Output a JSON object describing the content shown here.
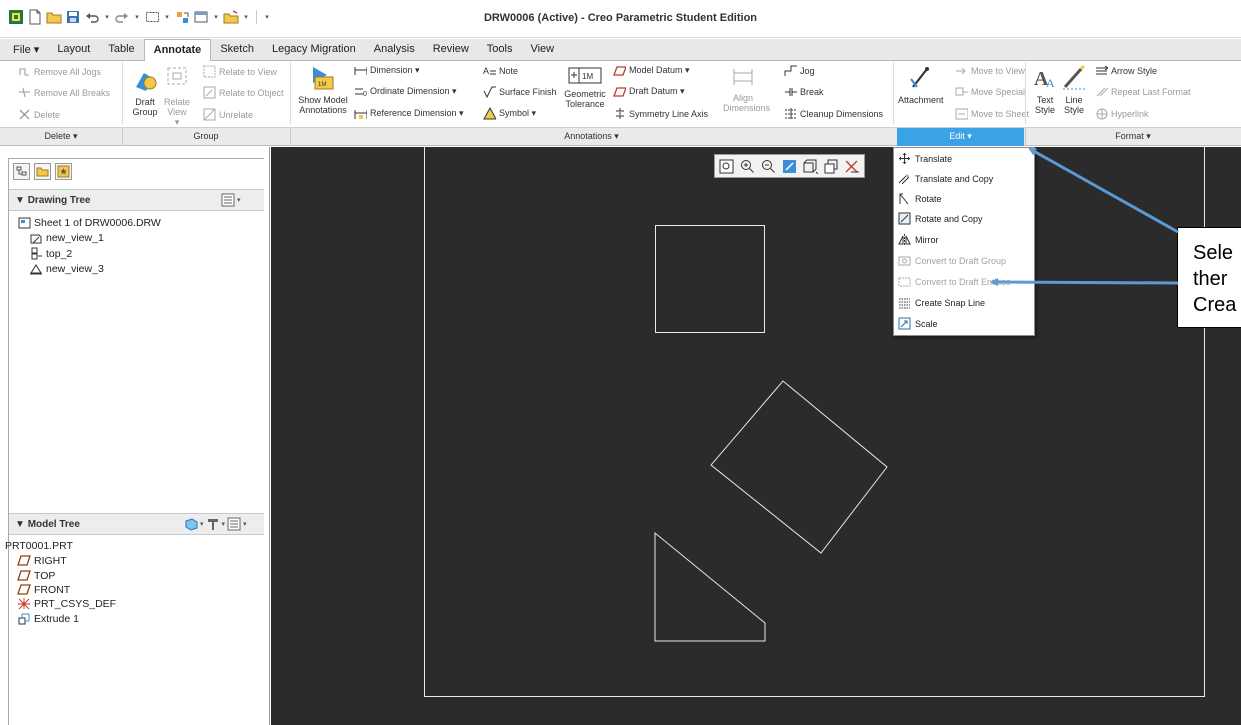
{
  "window": {
    "title": "DRW0006 (Active) - Creo Parametric Student Edition"
  },
  "tabs": [
    {
      "label": "File ▾"
    },
    {
      "label": "Layout"
    },
    {
      "label": "Table"
    },
    {
      "label": "Annotate"
    },
    {
      "label": "Sketch"
    },
    {
      "label": "Legacy Migration"
    },
    {
      "label": "Analysis"
    },
    {
      "label": "Review"
    },
    {
      "label": "Tools"
    },
    {
      "label": "View"
    }
  ],
  "ribbon": {
    "delete": {
      "remove_all_jogs": "Remove All Jogs",
      "remove_all_breaks": "Remove All Breaks",
      "delete": "Delete"
    },
    "group": {
      "draft_group": "Draft Group",
      "relate_view": "Relate View ▾",
      "relate_to_view": "Relate to View",
      "relate_to_object": "Relate to Object",
      "unrelate": "Unrelate"
    },
    "annotations": {
      "show_model_annotations": "Show Model Annotations",
      "dimension": "Dimension ▾",
      "ordinate_dimension": "Ordinate Dimension ▾",
      "reference_dimension": "Reference Dimension ▾",
      "note": "Note",
      "surface_finish": "Surface Finish",
      "symbol": "Symbol ▾",
      "geometric_tolerance": "Geometric Tolerance",
      "model_datum": "Model Datum ▾",
      "draft_datum": "Draft Datum ▾",
      "symmetry_line_axis": "Symmetry Line Axis",
      "align_dimensions": "Align Dimensions",
      "jog": "Jog",
      "break": "Break",
      "cleanup_dimensions": "Cleanup Dimensions"
    },
    "edit": {
      "attachment": "Attachment",
      "move_to_view": "Move to View",
      "move_special": "Move Special",
      "move_to_sheet": "Move to Sheet"
    },
    "format": {
      "text_style": "Text Style",
      "line_style": "Line Style",
      "arrow_style": "Arrow Style",
      "repeat_last_format": "Repeat Last Format",
      "hyperlink": "Hyperlink"
    }
  },
  "groups": {
    "delete": "Delete ▾",
    "group": "Group",
    "annotations": "Annotations ▾",
    "edit": "Edit ▾",
    "format": "Format ▾"
  },
  "drawing_tree": {
    "title": "Drawing Tree",
    "items": [
      "Sheet 1 of DRW0006.DRW",
      "new_view_1",
      "top_2",
      "new_view_3"
    ]
  },
  "model_tree": {
    "title": "Model Tree",
    "items": [
      "PRT0001.PRT",
      "RIGHT",
      "TOP",
      "FRONT",
      "PRT_CSYS_DEF",
      "Extrude 1"
    ]
  },
  "edit_menu": {
    "items": [
      {
        "label": "Translate",
        "enabled": true
      },
      {
        "label": "Translate and Copy",
        "enabled": true
      },
      {
        "label": "Rotate",
        "enabled": true
      },
      {
        "label": "Rotate and Copy",
        "enabled": true
      },
      {
        "label": "Mirror",
        "enabled": true
      },
      {
        "label": "Convert to Draft Group",
        "enabled": false
      },
      {
        "label": "Convert to Draft Entities",
        "enabled": false
      },
      {
        "label": "Create Snap Line",
        "enabled": true
      },
      {
        "label": "Scale",
        "enabled": true
      }
    ]
  },
  "callout": {
    "lines": [
      "Sele",
      "ther",
      "Crea"
    ]
  },
  "colors": {
    "accent": "#3aa2e6",
    "canvas": "#2b2b2b",
    "arrow": "#5b9bd5"
  }
}
